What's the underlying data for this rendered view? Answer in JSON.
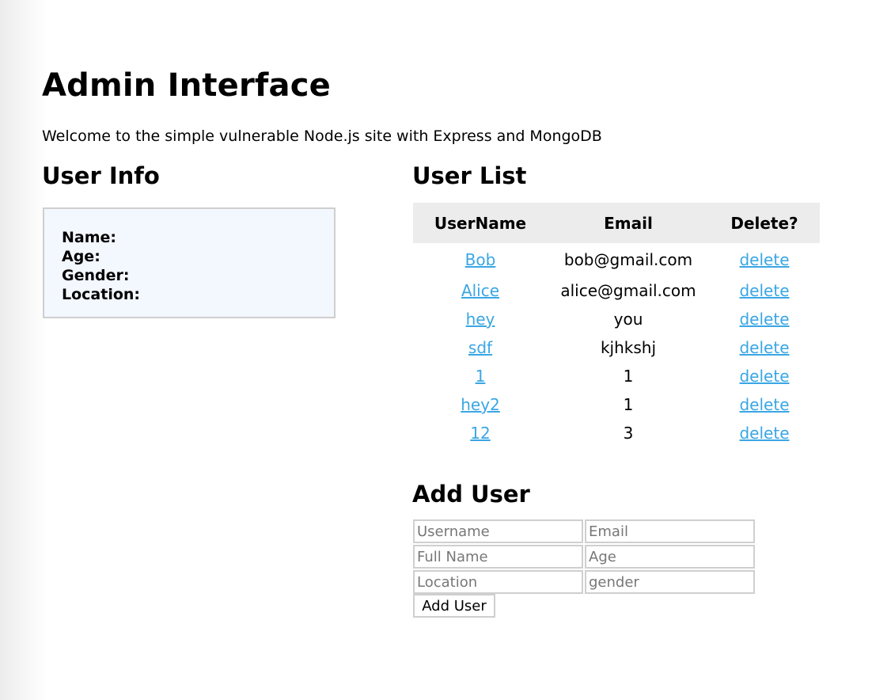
{
  "page": {
    "title": "Admin Interface",
    "welcome": "Welcome to the simple vulnerable Node.js site with Express and MongoDB"
  },
  "user_info": {
    "heading": "User Info",
    "fields": [
      "Name:",
      "Age:",
      "Gender:",
      "Location:"
    ]
  },
  "user_list": {
    "heading": "User List",
    "columns": [
      "UserName",
      "Email",
      "Delete?"
    ],
    "rows": [
      {
        "username": "Bob",
        "email": "bob@gmail.com",
        "delete": "delete"
      },
      {
        "username": "Alice",
        "email": "alice@gmail.com",
        "delete": "delete"
      },
      {
        "username": "hey",
        "email": "you",
        "delete": "delete"
      },
      {
        "username": "sdf",
        "email": "kjhkshj",
        "delete": "delete"
      },
      {
        "username": "1",
        "email": "1",
        "delete": "delete"
      },
      {
        "username": "hey2",
        "email": "1",
        "delete": "delete"
      },
      {
        "username": "12",
        "email": "3",
        "delete": "delete"
      }
    ]
  },
  "add_user": {
    "heading": "Add User",
    "placeholders": {
      "username": "Username",
      "email": "Email",
      "full_name": "Full Name",
      "age": "Age",
      "location": "Location",
      "gender": "gender"
    },
    "submit_label": "Add User"
  },
  "colors": {
    "link": "#3aa6e4",
    "info_box_bg": "#f3f7fe",
    "table_header_bg": "#ececec",
    "border": "#cfcfcf"
  }
}
